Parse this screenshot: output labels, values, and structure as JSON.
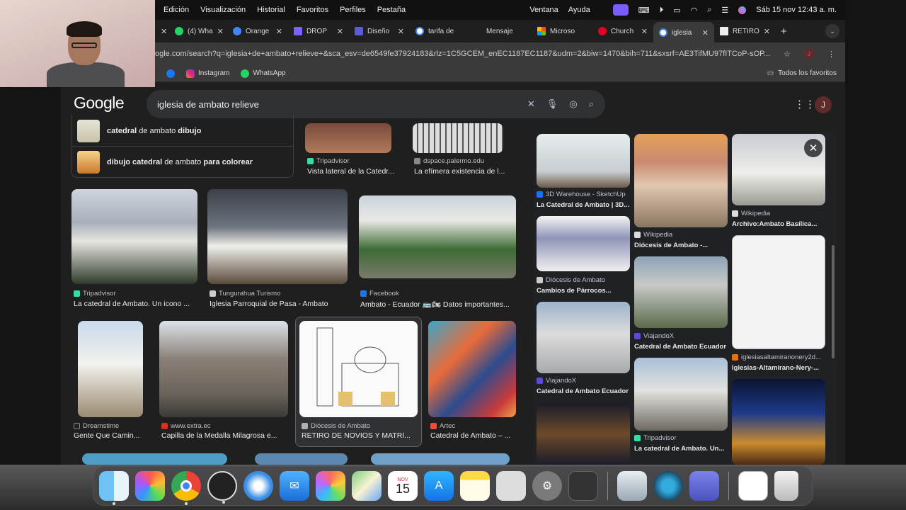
{
  "menubar": {
    "items": [
      "Edición",
      "Visualización",
      "Historial",
      "Favoritos",
      "Perfiles",
      "Pestaña"
    ],
    "right_items": [
      "Ventana",
      "Ayuda"
    ],
    "datetime": "Sáb 15 nov  12:43 a. m."
  },
  "tabs": [
    {
      "label": "(4) Wha",
      "color": "#25d366"
    },
    {
      "label": "Orange",
      "color": "#4285f4"
    },
    {
      "label": "DROP",
      "color": "#7b61ff"
    },
    {
      "label": "Diseño",
      "color": "#5b5bd6"
    },
    {
      "label": "tarifa de",
      "color": "#ffffff"
    },
    {
      "label": "Mensaje",
      "color": "#222222"
    },
    {
      "label": "Microso",
      "color": "#f25022"
    },
    {
      "label": "Church",
      "color": "#e60023"
    },
    {
      "label": "iglesia",
      "color": "#4285f4",
      "active": true
    },
    {
      "label": "RETIRO",
      "color": "#eeeeee"
    }
  ],
  "address": {
    "host": "ogle.com",
    "url": "ogle.com/search?q=iglesia+de+ambato+relieve+&sca_esv=de6549fe37924183&rlz=1C5GCEM_enEC1187EC1187&udm=2&biw=1470&bih=711&sxsrf=AE3TifMU97fITCoP-sOP..."
  },
  "bookmarks": [
    {
      "label": "Instagram",
      "color": "#e1306c"
    },
    {
      "label": "WhatsApp",
      "color": "#25d366"
    }
  ],
  "bookmarks_all": "Todos los favoritos",
  "google": {
    "logo": "Google",
    "query": "iglesia de ambato relieve",
    "avatar": "J"
  },
  "related": [
    {
      "bold1": "catedral",
      "mid": " de ambato ",
      "bold2": "dibujo",
      "tail": ""
    },
    {
      "bold1": "dibujo catedral",
      "mid": " de ambato ",
      "bold2": "para colorear",
      "tail": ""
    }
  ],
  "top_results": [
    {
      "source": "Tripadvisor",
      "title": "Vista lateral de la Catedr...",
      "color": "#34e0a1"
    },
    {
      "source": "dspace.palermo.edu",
      "title": "La efímera existencia de l...",
      "color": "#888888"
    }
  ],
  "results_row1": [
    {
      "source": "Tripadvisor",
      "title": "La catedral de Ambato. Un icono ...",
      "color": "#34e0a1"
    },
    {
      "source": "Tungurahua Turismo",
      "title": "Iglesia Parroquial de Pasa - Ambato",
      "color": "#cccccc"
    },
    {
      "source": "Facebook",
      "title": "Ambato - Ecuador 🚌🏍 Datos importantes...",
      "color": "#1877f2"
    }
  ],
  "results_row2": [
    {
      "source": "Dreamstime",
      "title": "Gente Que Camin...",
      "color": "#222222"
    },
    {
      "source": "www.extra.ec",
      "title": "Capilla de la Medalla Milagrosa e...",
      "color": "#d93025"
    },
    {
      "source": "Diócesis de Ambato",
      "title": "RETIRO DE NOVIOS Y MATRI...",
      "color": "#b0b0b0"
    },
    {
      "source": "Artec",
      "title": "Catedral de Ambato – ...",
      "color": "#e94d3d"
    }
  ],
  "panel": {
    "col1": [
      {
        "source": "3D Warehouse - SketchUp",
        "title": "La Catedral de Ambato | 3D...",
        "color": "#1a73e8"
      },
      {
        "source": "Diócesis de Ambato",
        "title": "Cambios de Párrocos...",
        "color": "#cccccc"
      },
      {
        "source": "ViajandoX",
        "title": "Catedral de Ambato Ecuador",
        "color": "#5b4bd6"
      }
    ],
    "col2": [
      {
        "source": "Wikipedia",
        "title": "Diócesis de Ambato -...",
        "color": "#dddddd"
      },
      {
        "source": "ViajandoX",
        "title": "Catedral de Ambato Ecuador",
        "color": "#5b4bd6"
      },
      {
        "source": "Tripadvisor",
        "title": "La catedral de Ambato. Un...",
        "color": "#34e0a1"
      }
    ],
    "col3": [
      {
        "source": "Wikipedia",
        "title": "Archivo:Ambato Basílica...",
        "color": "#dddddd"
      },
      {
        "source": "iglesiasaltamiranonery2d...",
        "title": "Iglesias-Altamirano-Nery-...",
        "color": "#e8710a"
      }
    ]
  },
  "dock": {
    "calendar_month": "NOV",
    "calendar_day": "15"
  }
}
